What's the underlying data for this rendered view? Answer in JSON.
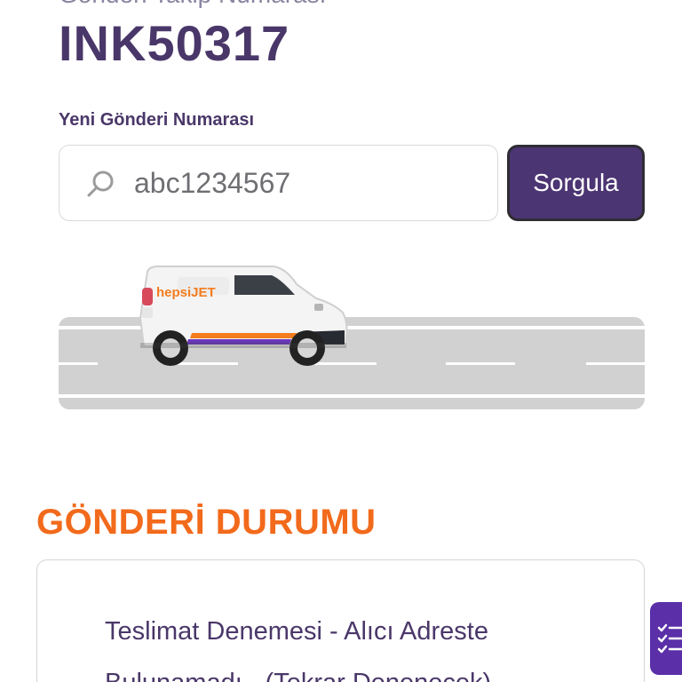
{
  "header": {
    "cut_label": "Gönderi Takip Numarası",
    "tracking_number": "INK50317"
  },
  "search": {
    "label": "Yeni Gönderi Numarası",
    "value": "abc1234567",
    "button_label": "Sorgula"
  },
  "illustration": {
    "brand_text": "hepsiJET"
  },
  "status": {
    "title": "GÖNDERİ DURUMU",
    "line1": "Teslimat Denemesi - Alıcı Adreste",
    "line2": "Bulunamadı - (Tekrar Denenecek)"
  },
  "colors": {
    "primary": "#4a3769",
    "accent": "#f26a1b",
    "widget": "#5b2fa8"
  },
  "icons": {
    "search": "search-icon",
    "widget": "checklist-icon"
  }
}
